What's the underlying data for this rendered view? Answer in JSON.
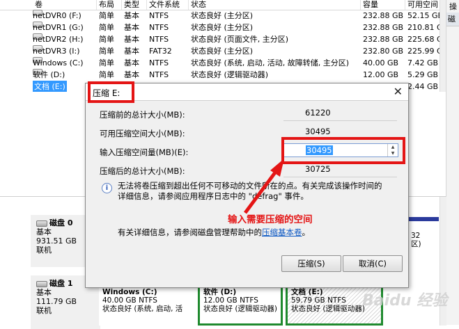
{
  "columns": [
    "卷",
    "布局",
    "类型",
    "文件系统",
    "状态",
    "容量",
    "可用空间"
  ],
  "volumes": [
    {
      "name": "netDVR0 (F:)",
      "layout": "简单",
      "type": "基本",
      "fs": "NTFS",
      "status": "状态良好 (主分区)",
      "capacity": "232.88 GB",
      "free": "52.15 GB"
    },
    {
      "name": "netDVR1 (G:)",
      "layout": "简单",
      "type": "基本",
      "fs": "NTFS",
      "status": "状态良好 (主分区)",
      "capacity": "232.88 GB",
      "free": "210.81 GB"
    },
    {
      "name": "netDVR2 (H:)",
      "layout": "简单",
      "type": "基本",
      "fs": "NTFS",
      "status": "状态良好 (页面文件, 主分区)",
      "capacity": "232.88 GB",
      "free": "225.68 GB"
    },
    {
      "name": "netDVR3 (I:)",
      "layout": "简单",
      "type": "基本",
      "fs": "FAT32",
      "status": "状态良好 (主分区)",
      "capacity": "232.80 GB",
      "free": "225.99 GB"
    },
    {
      "name": "Windows (C:)",
      "layout": "简单",
      "type": "基本",
      "fs": "NTFS",
      "status": "状态良好 (系统, 启动, 活动, 故障转储, 主分区)",
      "capacity": "40.00 GB",
      "free": "7.42 GB"
    },
    {
      "name": "软件 (D:)",
      "layout": "简单",
      "type": "基本",
      "fs": "NTFS",
      "status": "状态良好 (逻辑驱动器)",
      "capacity": "12.00 GB",
      "free": "5.29 GB"
    },
    {
      "name": "文档 (E:)",
      "layout": "",
      "type": "",
      "fs": "",
      "status": "",
      "capacity": "",
      "free": "2.44 GB"
    }
  ],
  "action_pane": {
    "title": "操",
    "item": "磁"
  },
  "disks": [
    {
      "name": "磁盘 0",
      "type": "基本",
      "size": "931.51 GB",
      "status": "联机"
    },
    {
      "name": "磁盘 1",
      "type": "基本",
      "size": "111.79 GB",
      "status": "联机"
    }
  ],
  "disk0_right_fragment": {
    "a": "32",
    "b": "区)"
  },
  "partitions": [
    {
      "name": "Windows (C:)",
      "size": "40.00 GB NTFS",
      "status": "状态良好 (系统, 启动, 活"
    },
    {
      "name": "软件 (D:)",
      "size": "12.00 GB NTFS",
      "status": "状态良好 (逻辑驱动器)"
    },
    {
      "name": "文档 (E:)",
      "size": "59.79 GB NTFS",
      "status": "状态良好 (逻辑驱动器)"
    }
  ],
  "dialog": {
    "title": "压缩 E:",
    "close": "✕",
    "fields": [
      {
        "label": "压缩前的总计大小(MB):",
        "value": "61220"
      },
      {
        "label": "可用压缩空间大小(MB):",
        "value": "30495"
      },
      {
        "label": "输入压缩空间量(MB)(E):",
        "value": "30495"
      },
      {
        "label": "压缩后的总计大小(MB):",
        "value": "30725"
      }
    ],
    "info_line1": "无法将卷压缩到超出任何不可移动的文件所在的点。有关完成该操作时间的",
    "info_line2": "详细信息，请参阅应用程序日志中的 \"defrag\" 事件。",
    "help_prefix": "有关详细信息，请参阅磁盘管理帮助中的",
    "help_link": "压缩基本卷",
    "help_suffix": "。",
    "ok_button": "压缩(S)",
    "cancel_button": "取消(C)"
  },
  "annotation": "输入需要压缩的空间",
  "watermark": "Baidu 经验",
  "colors": {
    "annotation_red": "#e41515",
    "selection_blue": "#3399ff",
    "partition_primary": "#2a3a9c",
    "partition_logical": "#1f8a2e"
  }
}
